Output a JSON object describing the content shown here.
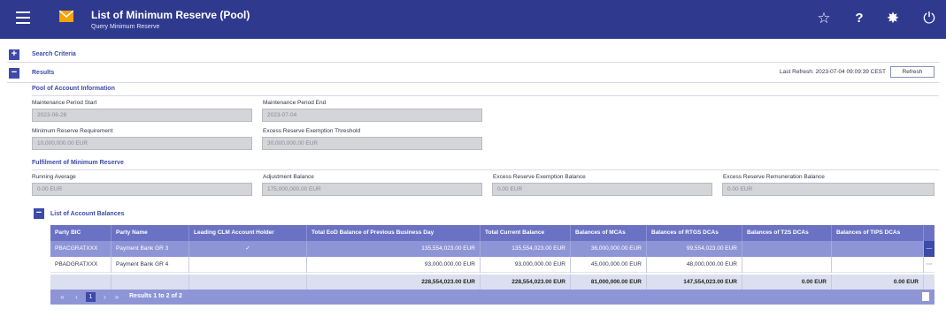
{
  "header": {
    "title": "List of Minimum Reserve (Pool)",
    "subtitle": "Query Minimum Reserve",
    "icons": [
      "menu-icon",
      "mail-icon",
      "star-icon",
      "help-icon",
      "gear-icon",
      "power-icon"
    ],
    "star_glyph": "☆",
    "help_glyph": "?",
    "gear_glyph": "✸",
    "power_glyph": "⏻"
  },
  "search_criteria": {
    "toggle": "+",
    "label": "Search Criteria"
  },
  "results": {
    "toggle": "−",
    "label": "Results",
    "last_refresh": "Last Refresh: 2023-07-04 09:09:39 CEST",
    "refresh_label": "Refresh"
  },
  "pool": {
    "title": "Pool of Account Information",
    "period_start_label": "Maintenance Period Start",
    "period_start_value": "2023-06-28",
    "period_end_label": "Maintenance Period End",
    "period_end_value": "2023-07-04",
    "min_reserve_label": "Minimum Reserve Requirement",
    "min_reserve_value": "10,000,000.00 EUR",
    "exemption_threshold_label": "Excess Reserve Exemption Threshold",
    "exemption_threshold_value": "30,000,000.00 EUR"
  },
  "fulfilment": {
    "title": "Fulfilment of Minimum Reserve",
    "running_average_label": "Running Average",
    "running_average_value": "0.00 EUR",
    "adjustment_label": "Adjustment Balance",
    "adjustment_value": "175,000,000.00 EUR",
    "exemption_balance_label": "Excess Reserve Exemption Balance",
    "exemption_balance_value": "0.00 EUR",
    "remuneration_label": "Excess Reserve Remuneration Balance",
    "remuneration_value": "0.00 EUR"
  },
  "balances": {
    "toggle": "−",
    "title": "List of Account Balances",
    "columns": [
      "Party BIC",
      "Party Name",
      "Leading CLM Account Holder",
      "Total EoD Balance of Previous Business Day",
      "Total Current Balance",
      "Balances of MCAs",
      "Balances of RTGS DCAs",
      "Balances of T2S DCAs",
      "Balances of TIPS DCAs"
    ],
    "rows": [
      {
        "bic": "PBACGRATXXX",
        "name": "Payment Bank GR 3",
        "leading": "✓",
        "eod": "135,554,023.00 EUR",
        "current": "135,554,023.00 EUR",
        "mca": "36,000,000.00 EUR",
        "rtgs": "99,554,023.00 EUR",
        "t2s": "",
        "tips": "",
        "action": "—"
      },
      {
        "bic": "PBADGRATXXX",
        "name": "Payment Bank GR 4",
        "leading": "",
        "eod": "93,000,000.00 EUR",
        "current": "93,000,000.00 EUR",
        "mca": "45,000,000.00 EUR",
        "rtgs": "48,000,000.00 EUR",
        "t2s": "",
        "tips": "",
        "action": "⋯"
      }
    ],
    "totals": {
      "eod": "228,554,023.00 EUR",
      "current": "228,554,023.00 EUR",
      "mca": "81,000,000.00 EUR",
      "rtgs": "147,554,023.00 EUR",
      "t2s": "0.00 EUR",
      "tips": "0.00 EUR"
    },
    "pager": {
      "first": "«",
      "prev": "‹",
      "page": "1",
      "next": "›",
      "last": "»",
      "summary": "Results 1 to 2 of 2"
    }
  }
}
